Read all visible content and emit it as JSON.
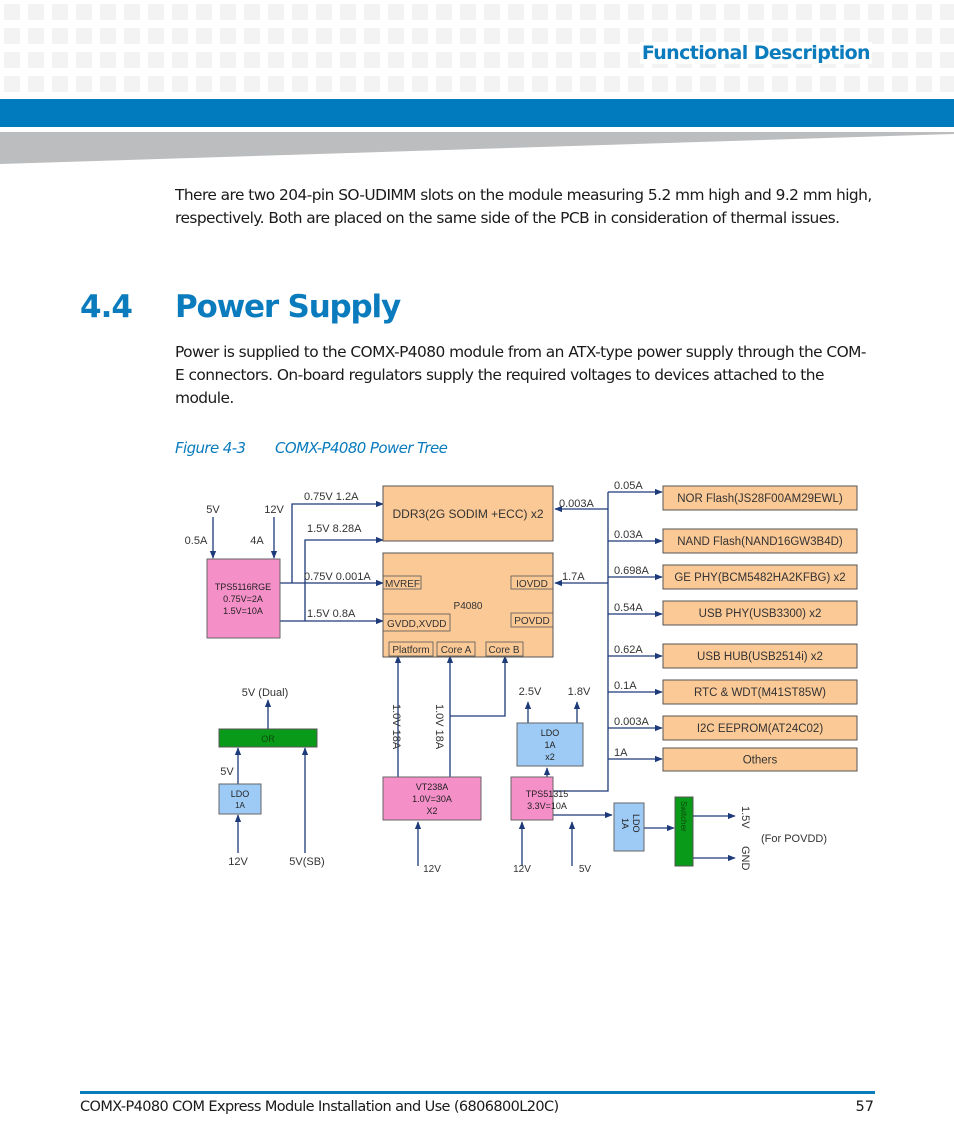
{
  "header": {
    "section_title": "Functional Description",
    "accent_color": "#017bbd"
  },
  "body": {
    "intro_paragraph": "There are two 204-pin SO-UDIMM slots on the module measuring 5.2 mm high and 9.2 mm high, respectively. Both are placed on the same side of the PCB in consideration of thermal issues.",
    "section_number": "4.4",
    "section_title": "Power Supply",
    "section_paragraph": "Power is supplied to the COMX-P4080 module from an ATX-type power supply through the COM-E connectors. On-board regulators supply the required voltages to devices attached to the module.",
    "figure_number": "Figure 4-3",
    "figure_title": "COMX-P4080 Power Tree"
  },
  "diagram": {
    "colors": {
      "regulator": "#f58fc8",
      "device": "#fbc996",
      "ldo": "#9ecbf5",
      "logic": "#0a9a1a",
      "wire": "#1d3a7a"
    },
    "tps5116": {
      "name": "TPS5116RGE",
      "line1": "0.75V=2A",
      "line2": "1.5V=10A",
      "in_5v": "5V",
      "in_5v_current": "0.5A",
      "in_12v": "12V",
      "in_12v_current": "4A"
    },
    "rails": {
      "ddr_075": "0.75V  1.2A",
      "ddr_15": "1.5V  8.28A",
      "mvref": "0.75V 0.001A",
      "gvdd": "1.5V  0.8A",
      "ddr_33": "0.003A",
      "iovdd": "1.7A"
    },
    "ddr3": {
      "label": "DDR3(2G SODIM +ECC) x2"
    },
    "p4080": {
      "label": "P4080",
      "mvref": "MVREF",
      "gvdd": "GVDD,XVDD",
      "iovdd": "IOVDD",
      "povdd": "POVDD",
      "platform": "Platform",
      "core_a": "Core A",
      "core_b": "Core B"
    },
    "core_rails": {
      "platform": "1.0V 18A",
      "cores": "1.0V 18A"
    },
    "vt238a": {
      "name": "VT238A",
      "line1": "1.0V=30A",
      "line2": "X2",
      "input": "12V"
    },
    "tps51315": {
      "name": "TPS51315",
      "line1": "3.3V=10A",
      "input1": "12V",
      "input2": "5V"
    },
    "ldo_small": {
      "line1": "LDO",
      "line2": "1A",
      "line3": "x2",
      "out1": "2.5V",
      "out2": "1.8V"
    },
    "ldo_povdd": {
      "line1": "LDO",
      "line2": "1A"
    },
    "switcher": {
      "label": "Switcher",
      "out1": "1.5V",
      "out2": "GND",
      "note": "(For POVDD)"
    },
    "dual": {
      "output": "5V (Dual)",
      "or_label": "OR",
      "ldo_line1": "LDO",
      "ldo_line2": "1A",
      "ldo_out": "5V",
      "in_12v": "12V",
      "in_sb": "5V(SB)"
    },
    "devices": [
      {
        "label": "NOR Flash(JS28F00AM29EWL)",
        "current": "0.05A"
      },
      {
        "label": "NAND Flash(NAND16GW3B4D)",
        "current": "0.03A"
      },
      {
        "label": "GE PHY(BCM5482HA2KFBG) x2",
        "current": "0.698A"
      },
      {
        "label": "USB PHY(USB3300) x2",
        "current": "0.54A"
      },
      {
        "label": "USB HUB(USB2514i) x2",
        "current": "0.62A"
      },
      {
        "label": "RTC & WDT(M41ST85W)",
        "current": "0.1A"
      },
      {
        "label": "I2C EEPROM(AT24C02)",
        "current": "0.003A"
      },
      {
        "label": "Others",
        "current": "1A"
      }
    ]
  },
  "footer": {
    "document_title": "COMX-P4080 COM Express Module Installation and Use (6806800L20C)",
    "page_number": "57"
  }
}
